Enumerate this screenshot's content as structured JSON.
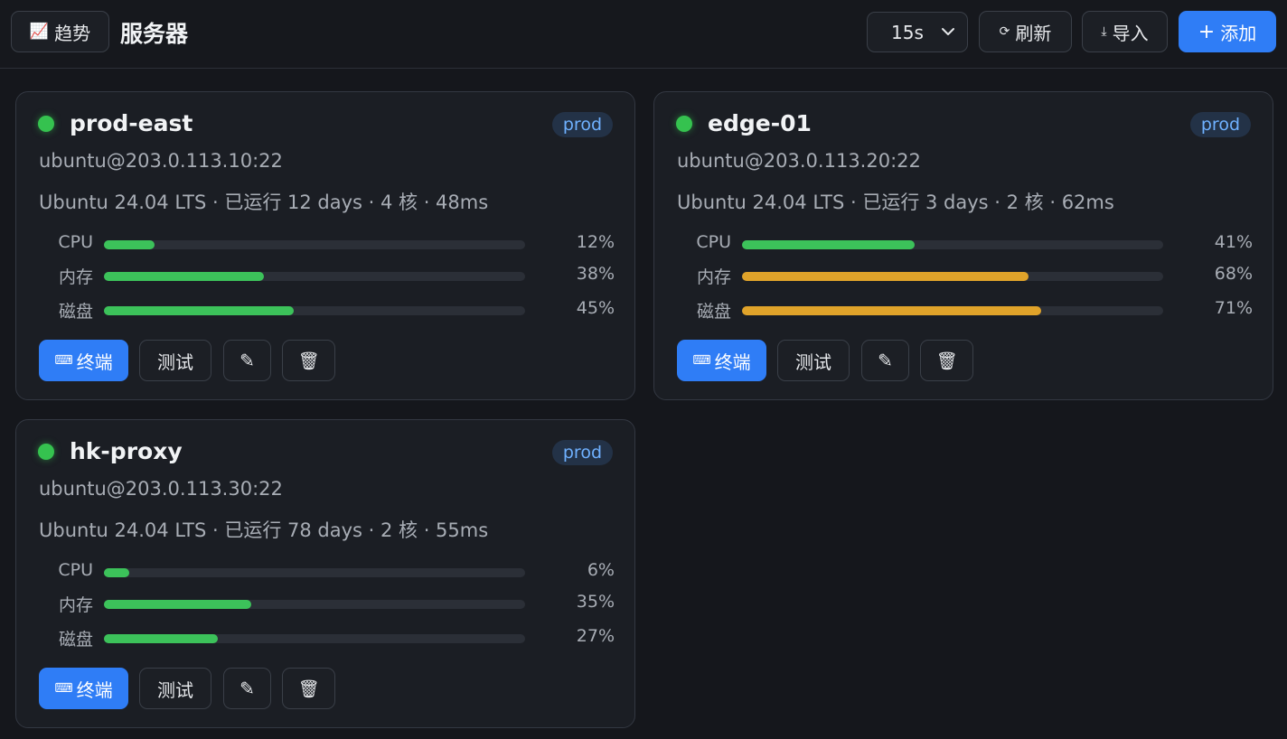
{
  "header": {
    "trend_icon": "📈",
    "trend_label": "趋势",
    "title": "服务器",
    "interval_value": "15s",
    "refresh_icon": "⟳",
    "refresh_label": "刷新",
    "import_icon": "⤓",
    "import_label": "导入",
    "add_icon": "+",
    "add_label": "添加"
  },
  "colors": {
    "accent": "#2f7df6",
    "online": "#35c24f",
    "ok_bar": "#3cc25a",
    "warn_bar": "#e0a32a",
    "tag_bg": "#233247",
    "tag_text": "#6fb1ff"
  },
  "labels": {
    "cpu": "CPU",
    "mem": "内存",
    "disk": "磁盘",
    "terminal_icon": "⌨",
    "terminal": "终端",
    "test": "测试",
    "edit_icon": "✎",
    "delete_icon": "🗑"
  },
  "servers": [
    {
      "name": "prod-east",
      "tag": "prod",
      "address": "ubuntu@203.0.113.10:22",
      "info": "Ubuntu 24.04 LTS · 已运行 12 days · 4 核 · 48ms",
      "cpu": 12,
      "cpu_text": "12%",
      "mem": 38,
      "mem_text": "38%",
      "disk": 45,
      "disk_text": "45%"
    },
    {
      "name": "edge-01",
      "tag": "prod",
      "address": "ubuntu@203.0.113.20:22",
      "info": "Ubuntu 24.04 LTS · 已运行 3 days · 2 核 · 62ms",
      "cpu": 41,
      "cpu_text": "41%",
      "mem": 68,
      "mem_text": "68%",
      "disk": 71,
      "disk_text": "71%"
    },
    {
      "name": "hk-proxy",
      "tag": "prod",
      "address": "ubuntu@203.0.113.30:22",
      "info": "Ubuntu 24.04 LTS · 已运行 78 days · 2 核 · 55ms",
      "cpu": 6,
      "cpu_text": "6%",
      "mem": 35,
      "mem_text": "35%",
      "disk": 27,
      "disk_text": "27%"
    }
  ]
}
